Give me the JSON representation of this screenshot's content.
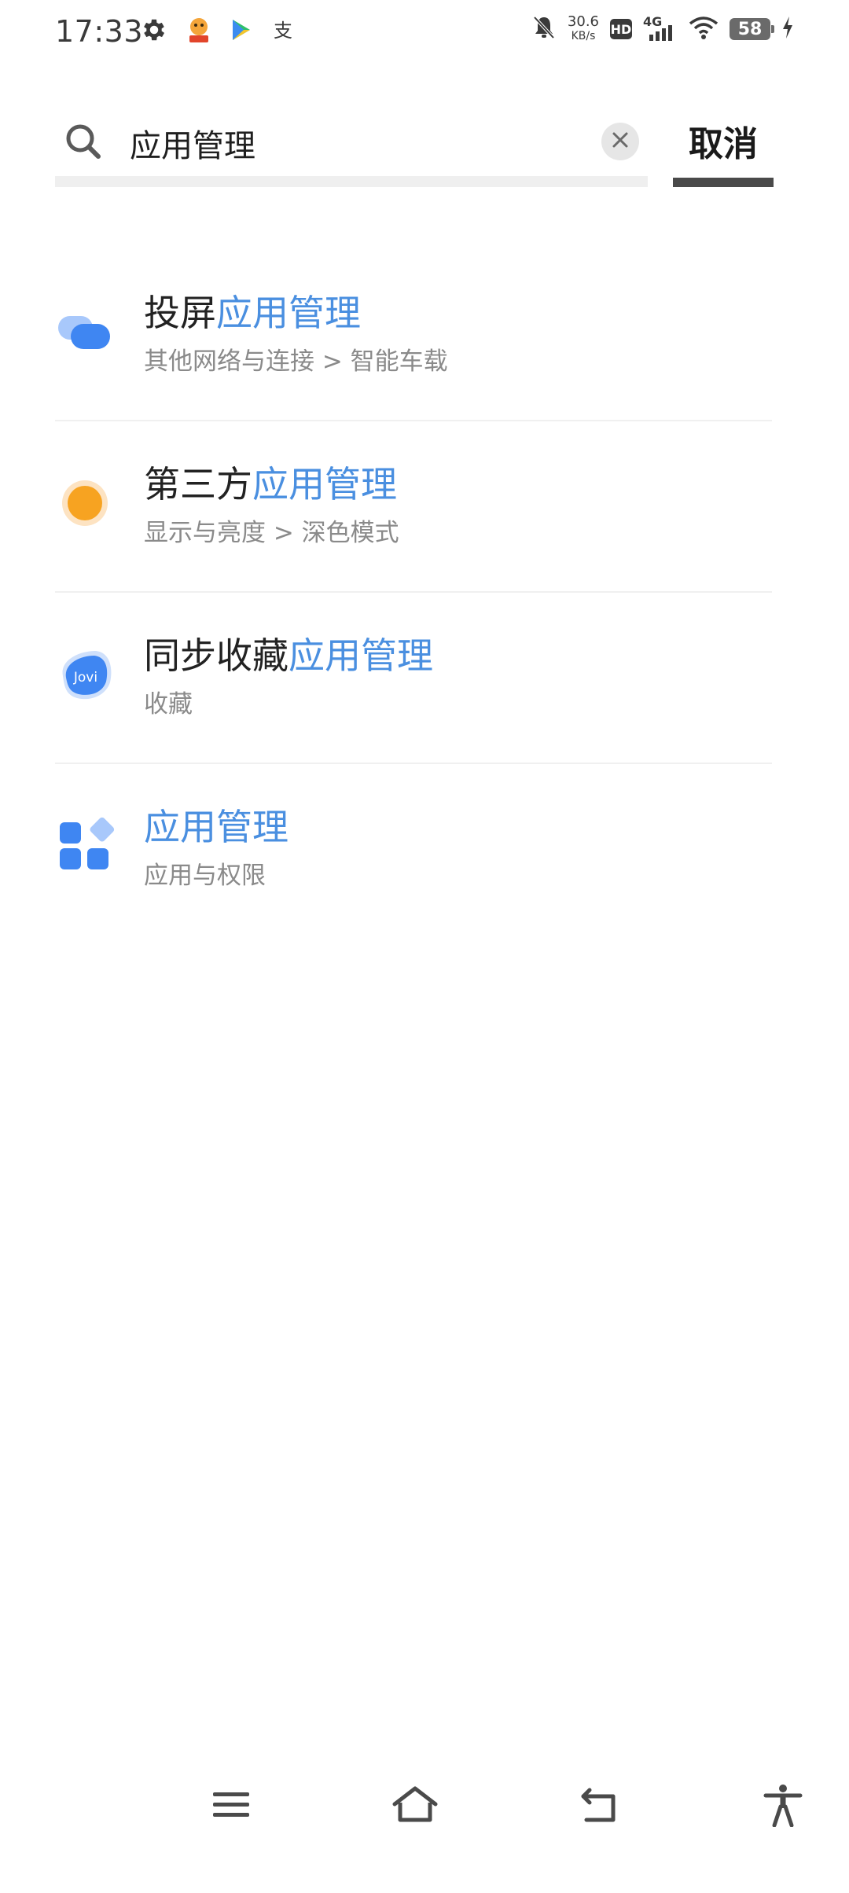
{
  "status_bar": {
    "time": "17:33",
    "left_icons": [
      "gear-icon",
      "app-mascot-icon",
      "play-store-icon",
      "alipay-icon"
    ],
    "net_speed_value": "30.6",
    "net_speed_unit": "KB/s",
    "hd_label": "HD",
    "network_label": "4G",
    "battery_level": "58",
    "charging": true,
    "right_icons": [
      "mute-bell-icon",
      "signal-icon",
      "wifi-icon",
      "battery-icon",
      "charging-bolt-icon"
    ]
  },
  "search": {
    "value": "应用管理",
    "placeholder": "",
    "cancel_label": "取消"
  },
  "results": [
    {
      "icon": "screen-cast-icon",
      "title_prefix": "投屏",
      "title_highlight": "应用管理",
      "subtitle": "其他网络与连接 > 智能车载"
    },
    {
      "icon": "dark-mode-sun-icon",
      "title_prefix": "第三方",
      "title_highlight": "应用管理",
      "subtitle": "显示与亮度 > 深色模式"
    },
    {
      "icon": "jovi-icon",
      "icon_text": "Jovi",
      "title_prefix": "同步收藏",
      "title_highlight": "应用管理",
      "subtitle": "收藏"
    },
    {
      "icon": "apps-grid-icon",
      "title_prefix": "",
      "title_highlight": "应用管理",
      "subtitle": "应用与权限"
    }
  ],
  "colors": {
    "highlight": "#4a8fe0",
    "primary_blue": "#3f86f2",
    "light_blue": "#a8c8fb",
    "orange": "#f7a321"
  },
  "nav_bar": {
    "items": [
      "menu-icon",
      "home-icon",
      "back-icon",
      "accessibility-icon"
    ]
  }
}
